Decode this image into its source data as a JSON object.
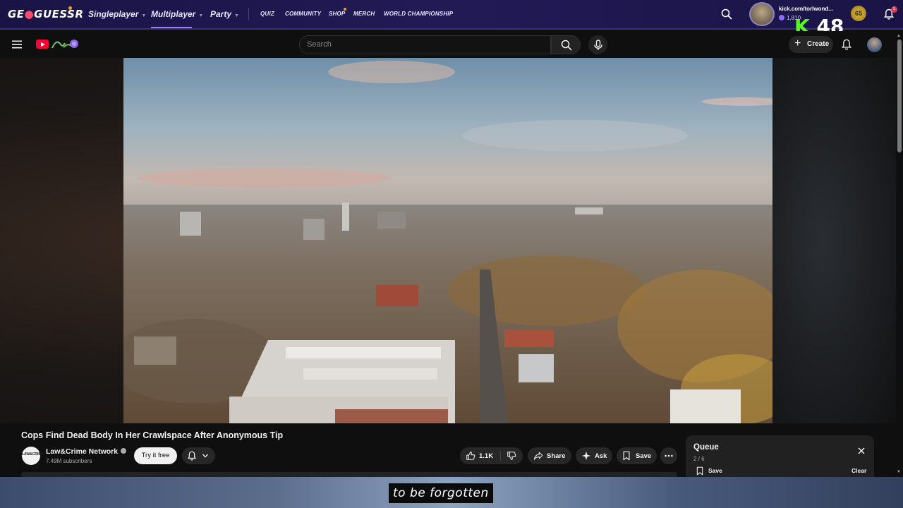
{
  "geoguessr": {
    "logo_pre": "GE",
    "logo_post": "GUESSR",
    "nav": [
      {
        "label": "Singleplayer"
      },
      {
        "label": "Multiplayer"
      },
      {
        "label": "Party"
      }
    ],
    "small_nav": [
      "QUIZ",
      "COMMUNITY",
      "SHOP",
      "MERCH",
      "WORLD CHAMPIONSHIP"
    ],
    "username": "kick.com/torlwond...",
    "coins": "1,810",
    "level": "65",
    "notification_count": "2",
    "brand_color": "#1a1446",
    "accent_color": "#9b7bff"
  },
  "overlay": {
    "kick_letter": "K",
    "kick_number": "48"
  },
  "youtube": {
    "search_placeholder": "Search",
    "create_label": "Create",
    "logo_color": "#ff0033"
  },
  "video": {
    "title": "Cops Find Dead Body In Her Crawlspace After Anonymous Tip",
    "channel_name": "Law&Crime Network",
    "channel_avatar_text": "LAW&CRIME",
    "subscribers": "7.49M subscribers",
    "try_label": "Try it free",
    "like_count": "1.1K",
    "share_label": "Share",
    "ask_label": "Ask",
    "save_label": "Save"
  },
  "queue": {
    "title": "Queue",
    "position": "2 / 6",
    "save_label": "Save",
    "clear_label": "Clear"
  },
  "subtitle": {
    "text": "to be forgotten"
  }
}
